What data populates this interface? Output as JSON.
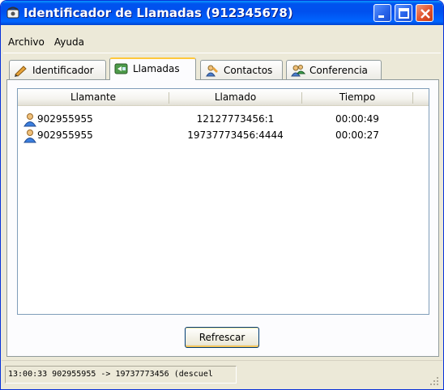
{
  "window": {
    "title": "Identificador de Llamadas (912345678)"
  },
  "menu": {
    "items": [
      "Archivo",
      "Ayuda"
    ]
  },
  "tabs": [
    {
      "label": "Identificador",
      "icon": "pencil-icon"
    },
    {
      "label": "Llamadas",
      "icon": "calls-icon",
      "active": true
    },
    {
      "label": "Contactos",
      "icon": "contacts-icon"
    },
    {
      "label": "Conferencia",
      "icon": "conference-icon"
    }
  ],
  "calls": {
    "columns": [
      "Llamante",
      "Llamado",
      "Tiempo"
    ],
    "rows": [
      {
        "from": "902955955",
        "to": "12127773456:1",
        "time": "00:00:49"
      },
      {
        "from": "902955955",
        "to": "19737773456:4444",
        "time": "00:00:27"
      }
    ]
  },
  "buttons": {
    "refresh": "Refrescar"
  },
  "status": {
    "text": "13:00:33 902955955 -> 19737773456 (descuel"
  },
  "colors": {
    "titlebar": "#0054e3",
    "close": "#e1512b",
    "tab_accent": "#ffc83c"
  }
}
